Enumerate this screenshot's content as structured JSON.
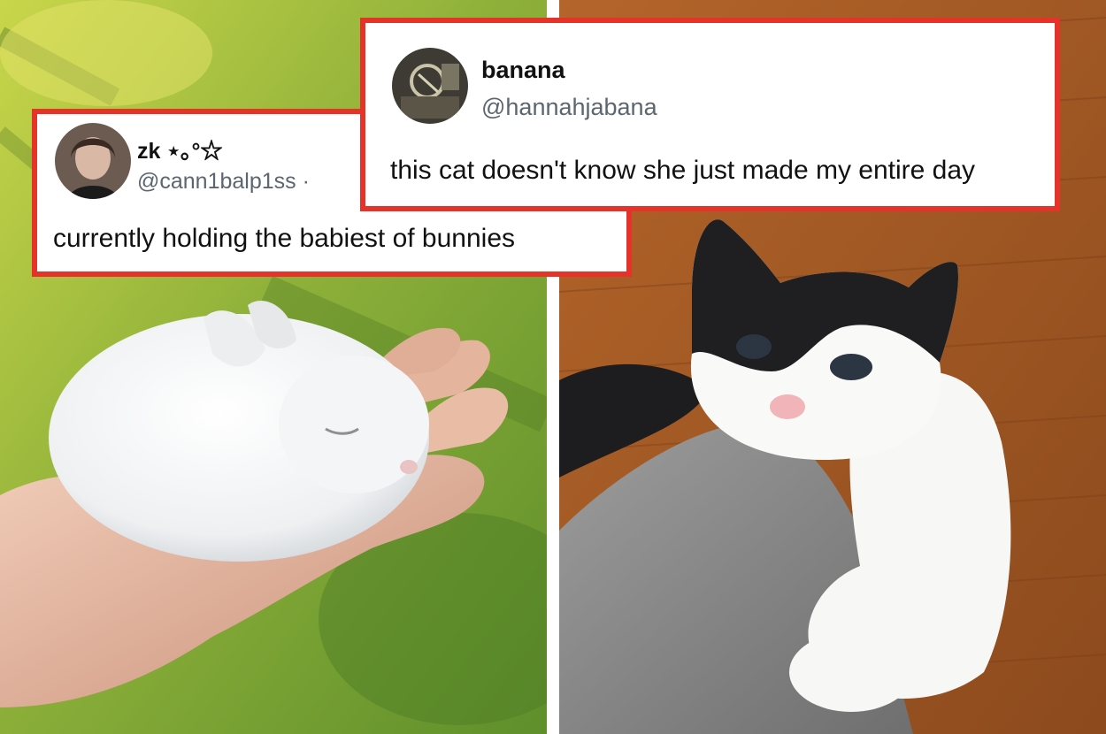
{
  "tweets": [
    {
      "display_name": "zk ⋆｡°☆",
      "handle": "@cann1balp1ss ·",
      "text": "currently holding the babiest of bunnies"
    },
    {
      "display_name": "banana",
      "handle": "@hannahjabana",
      "text": "this cat doesn't know she just made my entire day"
    }
  ],
  "colors": {
    "frame_border": "#e5332a",
    "handle_text": "#5b6670"
  }
}
